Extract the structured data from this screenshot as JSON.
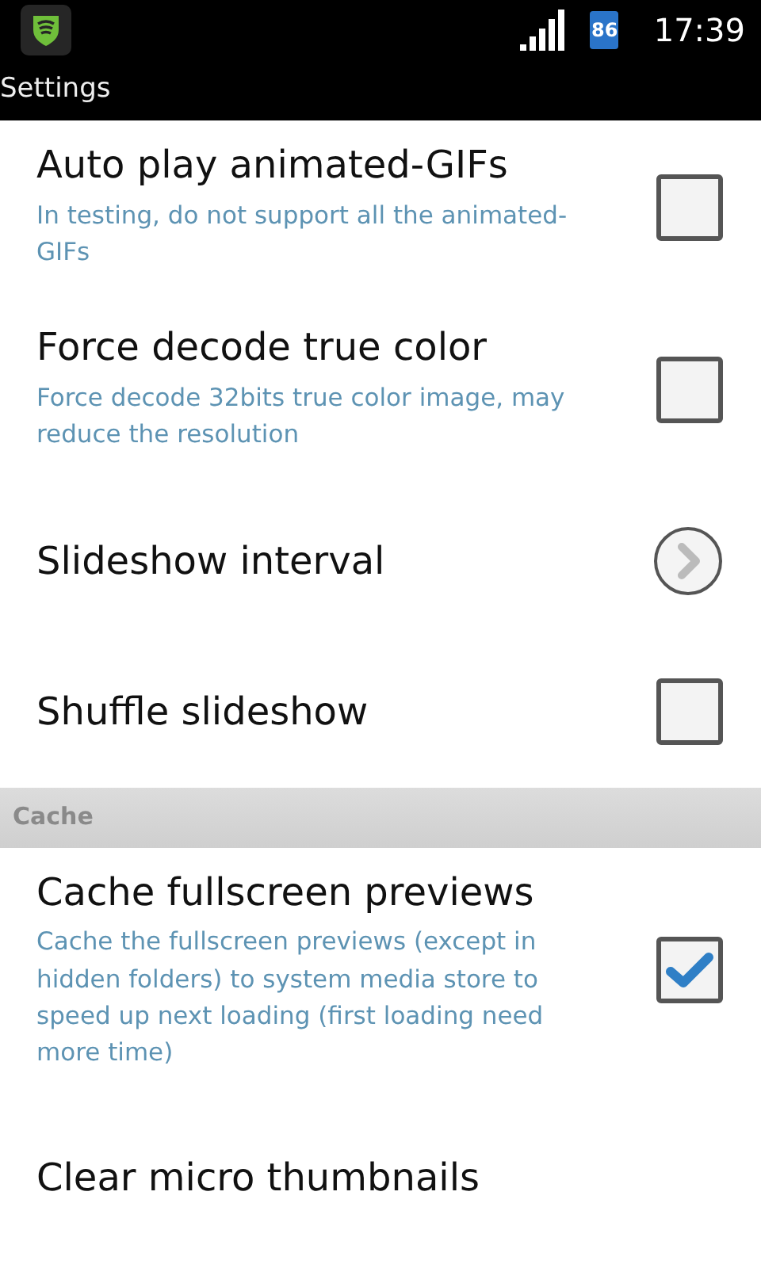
{
  "status_bar": {
    "battery": "86",
    "time": "17:39"
  },
  "title": "Settings",
  "sections": [
    {
      "items": [
        {
          "kind": "checkbox",
          "title": "Auto play animated-GIFs",
          "summary": "In testing, do not support all the animated-GIFs",
          "checked": false
        },
        {
          "kind": "checkbox",
          "title": "Force decode true color",
          "summary": "Force decode 32bits true color image, may reduce the resolution",
          "checked": false
        },
        {
          "kind": "link",
          "title": "Slideshow interval"
        },
        {
          "kind": "checkbox",
          "title": "Shuffle slideshow",
          "checked": false
        }
      ]
    },
    {
      "header": "Cache",
      "items": [
        {
          "kind": "checkbox",
          "title": "Cache fullscreen previews",
          "summary": "Cache the fullscreen previews (except in hidden folders) to system media store to speed up next loading (first loading need more time)",
          "checked": true
        },
        {
          "kind": "plain",
          "title": "Clear micro thumbnails"
        }
      ]
    }
  ]
}
